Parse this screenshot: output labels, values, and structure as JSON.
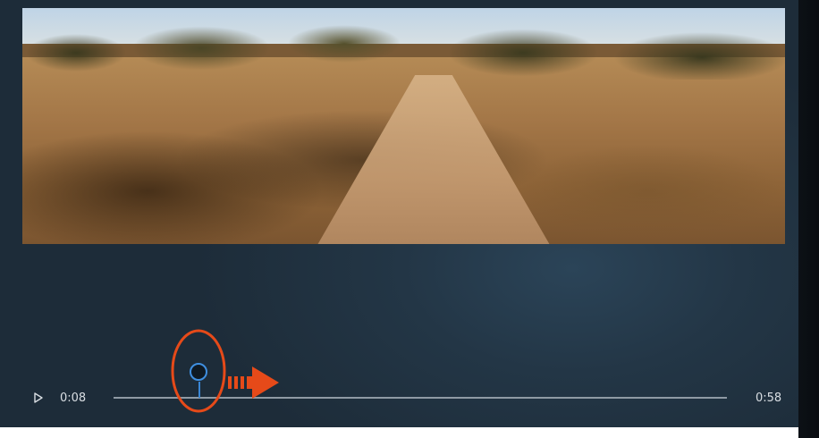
{
  "player": {
    "current_time": "0:08",
    "total_time": "0:58",
    "progress_fraction": 0.14
  },
  "colors": {
    "background": "#233646",
    "seek_track": "#8f9aa4",
    "seek_thumb_accent": "#3f8fe0",
    "annotation_highlight": "#e64a19"
  },
  "icons": {
    "play": "play-icon",
    "annotation": "drag-right-arrow-icon"
  }
}
